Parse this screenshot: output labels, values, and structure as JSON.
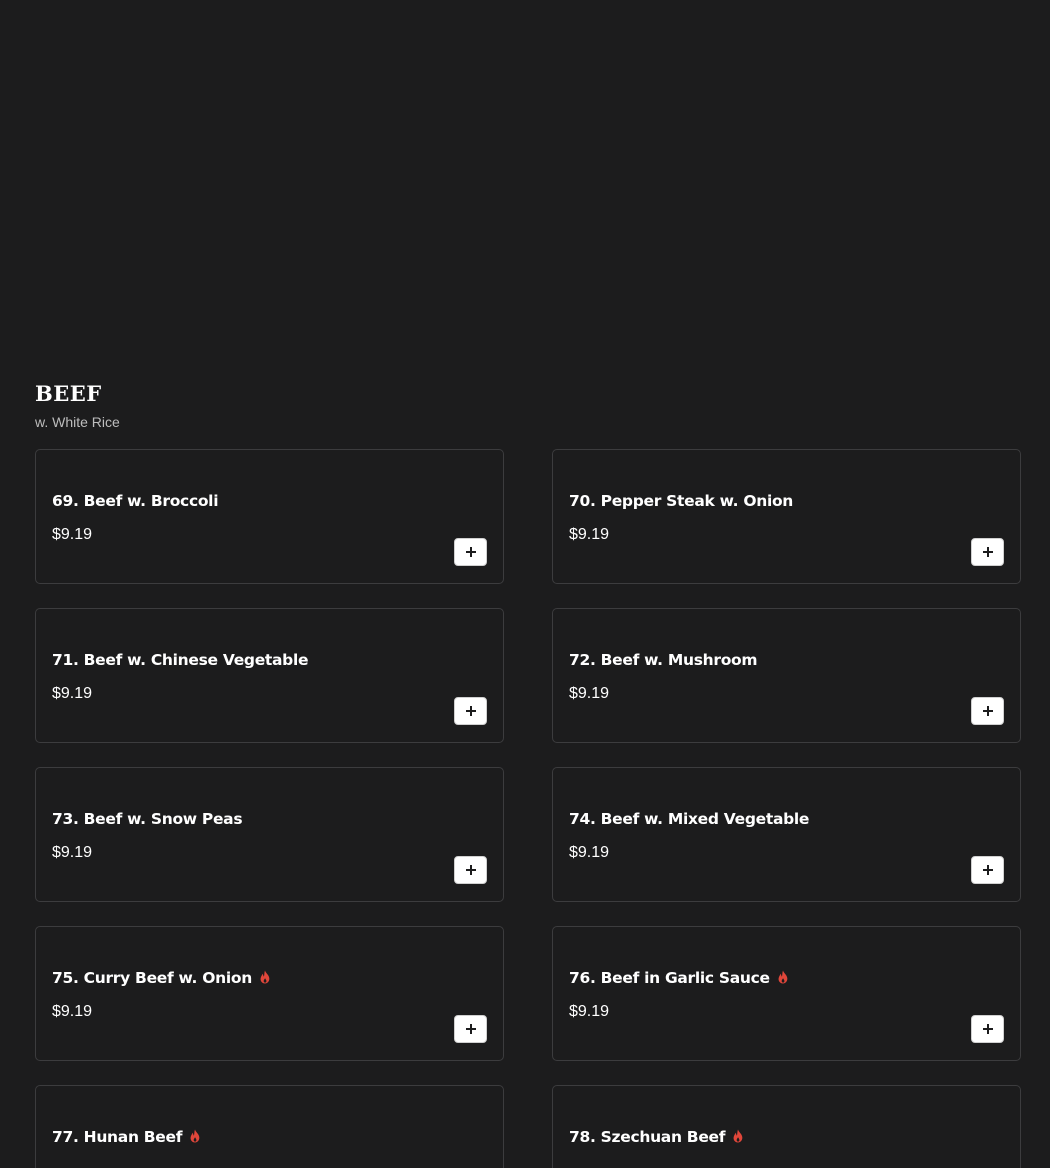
{
  "section": {
    "title": "BEEF",
    "subtitle": "w. White Rice"
  },
  "colors": {
    "background": "#1c1c1d",
    "card_border": "#3c3c3e",
    "spicy": "#e0463a",
    "button_bg": "#ffffff"
  },
  "items": [
    {
      "name": "69. Beef w. Broccoli",
      "price": "$9.19",
      "spicy": false
    },
    {
      "name": "70. Pepper Steak w. Onion",
      "price": "$9.19",
      "spicy": false
    },
    {
      "name": "71. Beef w. Chinese Vegetable",
      "price": "$9.19",
      "spicy": false
    },
    {
      "name": "72. Beef w. Mushroom",
      "price": "$9.19",
      "spicy": false
    },
    {
      "name": "73. Beef w. Snow Peas",
      "price": "$9.19",
      "spicy": false
    },
    {
      "name": "74. Beef w. Mixed Vegetable",
      "price": "$9.19",
      "spicy": false
    },
    {
      "name": "75. Curry Beef w. Onion",
      "price": "$9.19",
      "spicy": true
    },
    {
      "name": "76. Beef in Garlic Sauce",
      "price": "$9.19",
      "spicy": true
    },
    {
      "name": "77. Hunan Beef",
      "price": "",
      "spicy": true
    },
    {
      "name": "78. Szechuan Beef",
      "price": "",
      "spicy": true
    }
  ],
  "icons": {
    "spicy": "flame-icon",
    "add": "plus-icon"
  }
}
